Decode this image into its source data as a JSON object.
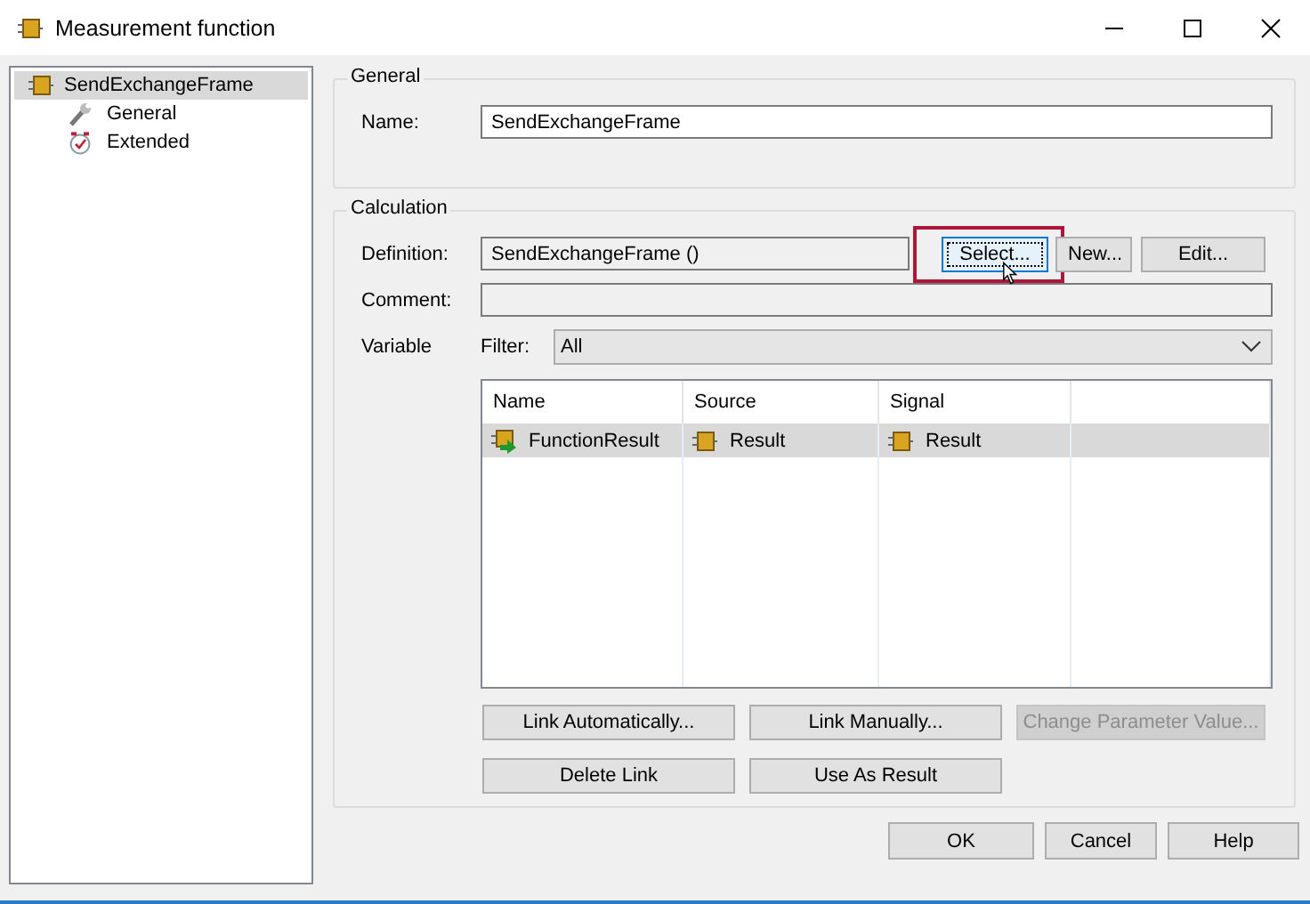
{
  "window": {
    "title": "Measurement function"
  },
  "tree": [
    {
      "label": "SendExchangeFrame",
      "selected": true,
      "kind": "function",
      "children": [
        {
          "label": "General",
          "selected": false,
          "kind": "wrench"
        },
        {
          "label": "Extended",
          "selected": false,
          "kind": "stopwatch"
        }
      ]
    }
  ],
  "general": {
    "title": "General",
    "name_label": "Name:",
    "name_value": "SendExchangeFrame"
  },
  "calculation": {
    "title": "Calculation",
    "definition_label": "Definition:",
    "definition_value": "SendExchangeFrame ()",
    "definition_buttons": [
      {
        "label": "Select...",
        "focused": true,
        "highlighted": true
      },
      {
        "label": "New...",
        "focused": false,
        "highlighted": false
      },
      {
        "label": "Edit...",
        "focused": false,
        "highlighted": false
      }
    ],
    "comment_label": "Comment:",
    "variable_label": "Variable",
    "filter_label": "Filter:",
    "filter_value": "All",
    "table": {
      "columns": [
        "Name",
        "Source",
        "Signal"
      ],
      "rows": [
        {
          "selected": true,
          "cells": [
            {
              "text": "FunctionResult",
              "kind": "result"
            },
            {
              "text": "Result",
              "kind": "function"
            },
            {
              "text": "Result",
              "kind": "function"
            }
          ]
        }
      ]
    },
    "buttons": [
      {
        "label": "Link Automatically...",
        "disabled": false
      },
      {
        "label": "Link Manually...",
        "disabled": false
      },
      {
        "label": "Change Parameter Value...",
        "disabled": true
      },
      {
        "label": "Delete Link",
        "disabled": false
      },
      {
        "label": "Use As Result",
        "disabled": false
      }
    ]
  },
  "footer_buttons": [
    "OK",
    "Cancel",
    "Help"
  ]
}
